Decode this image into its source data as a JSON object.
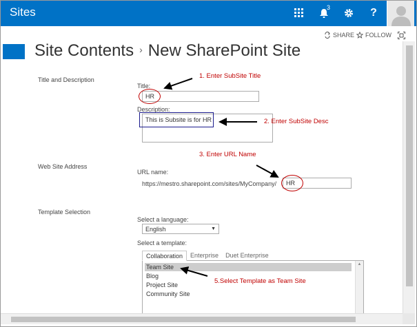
{
  "suite": {
    "title": "Sites",
    "notification_count": "3",
    "help_label": "?"
  },
  "actions": {
    "share": "SHARE",
    "follow": "FOLLOW"
  },
  "breadcrumb": {
    "parent": "Site Contents",
    "separator": "›",
    "current": "New SharePoint Site"
  },
  "sections": {
    "title_desc": "Title and Description",
    "web_address": "Web Site Address",
    "template": "Template Selection"
  },
  "form": {
    "title_label": "Title:",
    "title_value": "HR",
    "description_label": "Description:",
    "description_value": "This is Subsite is for HR",
    "url_label": "URL name:",
    "url_prefix": "https://mestro.sharepoint.com/sites/MyCompany/",
    "url_value": "HR",
    "language_label": "Select a language:",
    "language_value": "English",
    "template_label": "Select a template:"
  },
  "template_tabs": [
    "Collaboration",
    "Enterprise",
    "Duet Enterprise"
  ],
  "templates": [
    "Team Site",
    "Blog",
    "Project Site",
    "Community Site"
  ],
  "annotations": {
    "step1": "1. Enter SubSite Title",
    "step2": "2. Enter SubSite Desc",
    "step3": "3. Enter URL Name",
    "step5": "5.Select Template as Team Site"
  },
  "colors": {
    "suite_bar": "#0072c6",
    "annotation": "#c00000",
    "highlight_box": "#1a1a8c"
  }
}
